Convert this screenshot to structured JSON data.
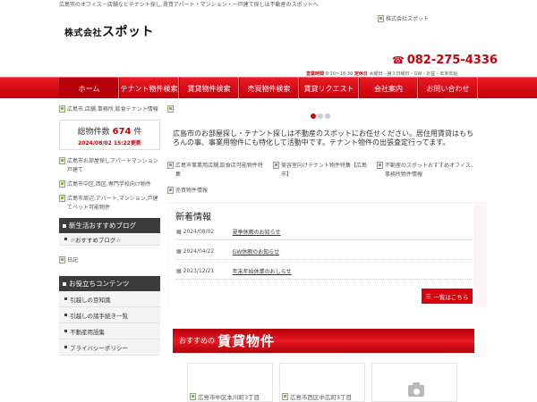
{
  "header": {
    "tagline": "広島市のオフィス・店舗などテナント探し,賃貸アパート・マンション・一戸建て探しは不動産のスポットへ",
    "logo_prefix": "株式会社",
    "logo_name": "スポット",
    "logo_image_alt": "株式会社スポット",
    "phone": "082-275-4336",
    "hours_label": "営業時間",
    "hours": "9:30～18:30",
    "holiday_label": "定休日",
    "holiday": "水曜日・第３日曜日・GW・お盆・年末年始"
  },
  "nav": {
    "items": [
      {
        "label": "ホーム"
      },
      {
        "label": "テナント物件検索"
      },
      {
        "label": "賃貸物件検索"
      },
      {
        "label": "売買物件検索"
      },
      {
        "label": "賃貸リクエスト"
      },
      {
        "label": "会社案内"
      },
      {
        "label": "お問い合わせ"
      }
    ]
  },
  "sidebar": {
    "top_link_alt": "広島市,店舗,事務所,飲食テナント情報",
    "count_label": "総物件数",
    "count_value": "674",
    "count_unit": "件",
    "count_date": "2024/08/02 15:22更新",
    "image_links": [
      "広島市お部屋探しアパートマンション戸建て",
      "広島市中区,西区,専門学校向け物件",
      "広島市周辺,アパート,マンション,戸建てペット可能物件"
    ],
    "blog_heading": "新生活おすすめブログ",
    "blog_link": "☆おすすめブログ☆",
    "diary_alt": "日記",
    "useful_heading": "お役立ちコンテンツ",
    "useful_links": [
      "引越しの豆知識",
      "引越しの諸手続き一覧",
      "不動産用語集",
      "プライバシーポリシー"
    ]
  },
  "main": {
    "intro": "広島市のお部屋探し・テナント探しは不動産のスポットにお任せください。居住用賃貸はもちろんの事、事業用物件にも特化して活動中です。テナント物件の出張査定行ってます。",
    "feature_links": [
      "広島市事業用店舗,飲食店可能物件特集",
      "美容室向けテナント物件特集【広島市】",
      "不動産のスポットおすすめオフィス、事務所物件情報",
      "売買物件情報"
    ],
    "news_title": "新着情報",
    "news": [
      {
        "date": "2024/08/02",
        "title": "夏季休暇のお知らせ"
      },
      {
        "date": "2024/04/22",
        "title": "GW休暇のお知らせ"
      },
      {
        "date": "2023/12/21",
        "title": "年末年始休業のおしらせ"
      }
    ],
    "news_all_button": "一覧はこちら",
    "banner_small": "おすすめの",
    "banner_large": "賃貸物件",
    "property_cards": [
      "広島市中区本川町3丁目",
      "広島市西区中広町3丁目"
    ]
  },
  "colors": {
    "accent": "#d9000c",
    "nav": "#c4000a",
    "pink_bg": "#fdf2f5"
  }
}
